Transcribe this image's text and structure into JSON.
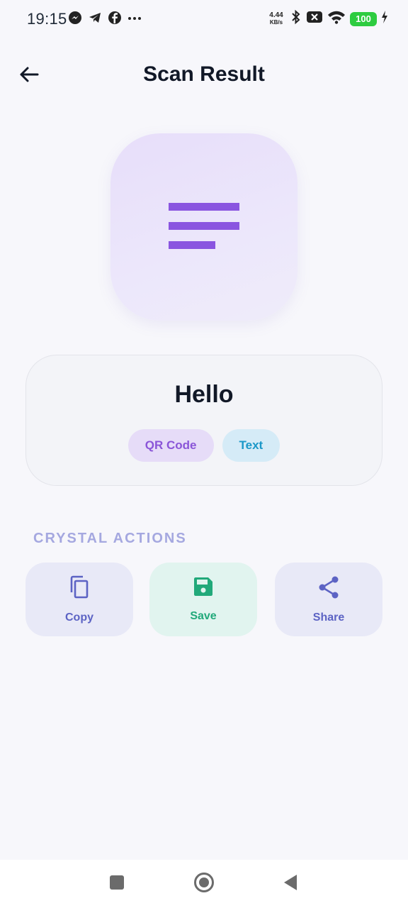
{
  "status_bar": {
    "time": "19:15",
    "net_speed_value": "4.44",
    "net_speed_unit": "KB/s",
    "battery": "100"
  },
  "header": {
    "title": "Scan Result"
  },
  "result": {
    "text": "Hello",
    "chips": [
      "QR Code",
      "Text"
    ]
  },
  "actions": {
    "section_title": "CRYSTAL ACTIONS",
    "items": [
      {
        "label": "Copy",
        "icon": "copy-icon"
      },
      {
        "label": "Save",
        "icon": "save-icon"
      },
      {
        "label": "Share",
        "icon": "share-icon"
      }
    ]
  },
  "colors": {
    "accent_purple": "#8a55d8",
    "accent_blue": "#1b98c8",
    "action_indigo": "#5c63c4",
    "action_green": "#21a97a"
  }
}
